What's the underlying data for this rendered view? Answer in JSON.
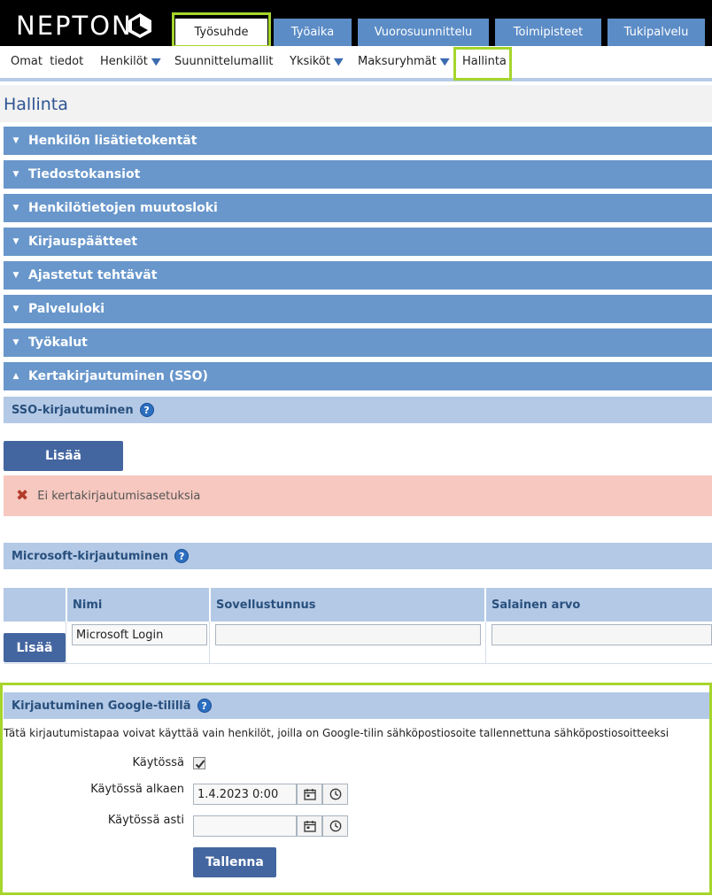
{
  "app": {
    "logo_text": "NEPTON"
  },
  "main_tabs": [
    {
      "label": "Työsuhde",
      "active": true
    },
    {
      "label": "Työaika"
    },
    {
      "label": "Vuorosuunnittelu"
    },
    {
      "label": "Toimipisteet"
    },
    {
      "label": "Tukipalvelu"
    }
  ],
  "sub_nav": [
    {
      "label": "Omat  tiedot"
    },
    {
      "label": "Henkilöt",
      "dropdown": true
    },
    {
      "label": "Suunnittelumallit"
    },
    {
      "label": "Yksiköt",
      "dropdown": true
    },
    {
      "label": "Maksuryhmät",
      "dropdown": true
    },
    {
      "label": "Hallinta",
      "active": true
    }
  ],
  "page": {
    "title": "Hallinta"
  },
  "accordions": [
    {
      "label": "Henkilön lisätietokentät",
      "expanded": false
    },
    {
      "label": "Tiedostokansiot",
      "expanded": false
    },
    {
      "label": "Henkilötietojen muutosloki",
      "expanded": false
    },
    {
      "label": "Kirjauspäätteet",
      "expanded": false
    },
    {
      "label": "Ajastetut tehtävät",
      "expanded": false
    },
    {
      "label": "Palveluloki",
      "expanded": false
    },
    {
      "label": "Työkalut",
      "expanded": false
    },
    {
      "label": "Kertakirjautuminen (SSO)",
      "expanded": true
    }
  ],
  "sso": {
    "header": "SSO-kirjautuminen",
    "add_label": "Lisää",
    "error_text": "Ei kertakirjautumisasetuksia"
  },
  "microsoft": {
    "header": "Microsoft-kirjautuminen",
    "columns": [
      "Nimi",
      "Sovellustunnus",
      "Salainen arvo"
    ],
    "add_label": "Lisää",
    "row": {
      "name": "Microsoft Login",
      "app_id": "",
      "secret": ""
    }
  },
  "google": {
    "header": "Kirjautuminen Google-tilillä",
    "description": "Tätä kirjautumistapaa voivat käyttää vain henkilöt, joilla on Google-tilin sähköpostiosoite tallennettuna sähköpostiosoitteeksi",
    "enabled_label": "Käytössä",
    "enabled": true,
    "start_label": "Käytössä alkaen",
    "start_value": "1.4.2023 0:00",
    "end_label": "Käytössä asti",
    "end_value": "",
    "save_label": "Tallenna"
  },
  "colors": {
    "accordion": "#6997cb",
    "section_header": "#b3c9e6",
    "button": "#4466a0",
    "highlight": "#a6d52c",
    "error_bg": "#f7c8bf"
  }
}
